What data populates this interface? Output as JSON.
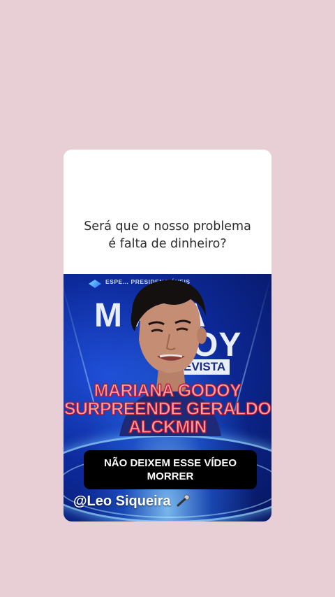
{
  "post": {
    "caption_line1": "Será que o nosso problema",
    "caption_line2": "é falta de dinheiro?"
  },
  "video": {
    "banner_text": "ESPE… PRESIDENCIÁVEIS",
    "bg_title_line1": "M    ANA",
    "bg_title_line2": "    ODOY",
    "bg_subtitle": "EVISTA",
    "headline_line1": "MARIANA GODOY",
    "headline_line2": "SURPREENDE GERALDO",
    "headline_line3": "ALCKMIN",
    "warning_line1": "NÃO DEIXEM ESSE VÍDEO",
    "warning_line2": "MORRER",
    "watermark": "@Leo Siqueira",
    "watermark_icon": "microphone-icon"
  },
  "colors": {
    "page_background": "#e8cfd6",
    "headline_fill": "#f3a6b0",
    "headline_stroke": "#c4182c"
  }
}
